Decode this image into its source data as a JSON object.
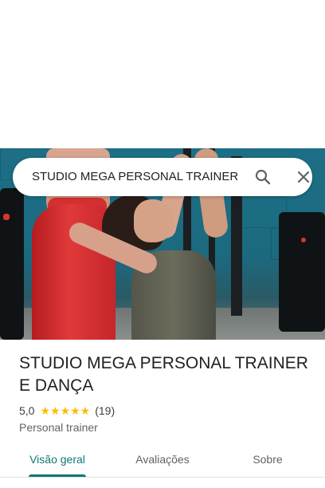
{
  "search": {
    "query": "STUDIO MEGA PERSONAL TRAINER",
    "search_icon": "search-icon",
    "close_icon": "close-icon"
  },
  "place": {
    "name": "STUDIO MEGA PERSONAL TRAINER E DANÇA",
    "rating": "5,0",
    "stars": "★★★★★",
    "review_count": "(19)",
    "category": "Personal trainer"
  },
  "tabs": [
    {
      "label": "Visão geral",
      "active": true
    },
    {
      "label": "Avaliações",
      "active": false
    },
    {
      "label": "Sobre",
      "active": false
    }
  ],
  "colors": {
    "accent": "#0b7a73",
    "star": "#fbbc04",
    "text_primary": "#202124",
    "text_secondary": "#5f6368"
  }
}
